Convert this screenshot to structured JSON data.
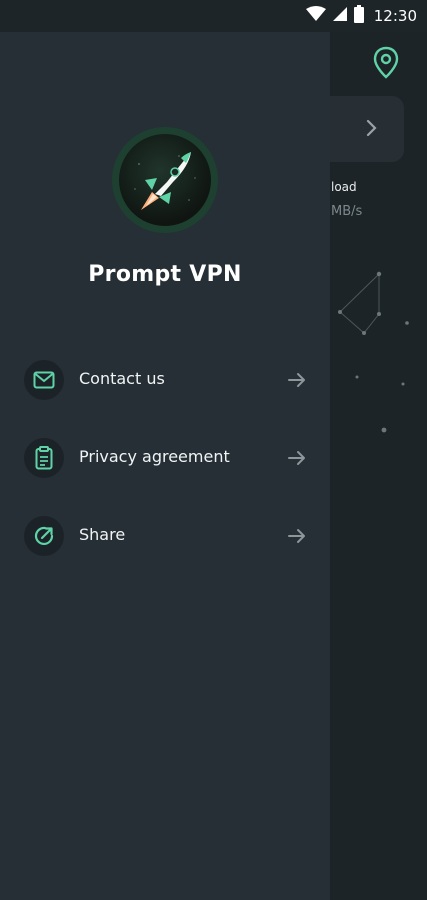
{
  "status_bar": {
    "time": "12:30"
  },
  "background": {
    "download_label": "load",
    "download_value": "MB/s"
  },
  "drawer": {
    "app_name": "Prompt VPN",
    "menu": [
      {
        "label": "Contact us",
        "icon": "mail-icon"
      },
      {
        "label": "Privacy agreement",
        "icon": "clipboard-icon"
      },
      {
        "label": "Share",
        "icon": "share-icon"
      }
    ]
  },
  "colors": {
    "accent": "#5fd3a6",
    "drawer_bg": "#262f35",
    "screen_bg": "#1d2428",
    "icon_circle": "#1c2328"
  }
}
